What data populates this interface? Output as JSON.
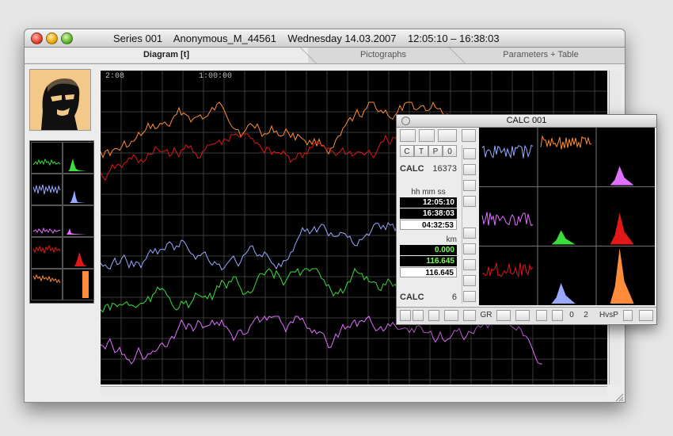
{
  "window": {
    "title": "Series 001    Anonymous_M_44561    Wednesday 14.03.2007    12:05:10 – 16:38:03",
    "tabs": [
      {
        "label": "Diagram [t]",
        "active": true
      },
      {
        "label": "Pictographs",
        "active": false
      },
      {
        "label": "Parameters  +  Table",
        "active": false
      }
    ]
  },
  "plot": {
    "time_labels": [
      "2:08",
      "1:00:00"
    ],
    "series_colors": [
      "#ff8c3a",
      "#e01818",
      "#9aa8ff",
      "#3cdc3c",
      "#e070ff"
    ]
  },
  "calc": {
    "title": "CALC 001",
    "mode_letters": [
      "C",
      "T",
      "P",
      "0"
    ],
    "calc_label": "CALC",
    "calc_value": "16373",
    "time_header": "hh mm ss",
    "time_values": [
      "12:05:10",
      "16:38:03",
      "04:32:53"
    ],
    "km_header": "km",
    "km_values": [
      "0.000",
      "116.645",
      "116.645"
    ],
    "calc2_label": "CALC",
    "calc2_value": "6",
    "bottom": {
      "gr": "GR",
      "zero": "0",
      "two": "2",
      "hvsp": "HvsP"
    }
  }
}
